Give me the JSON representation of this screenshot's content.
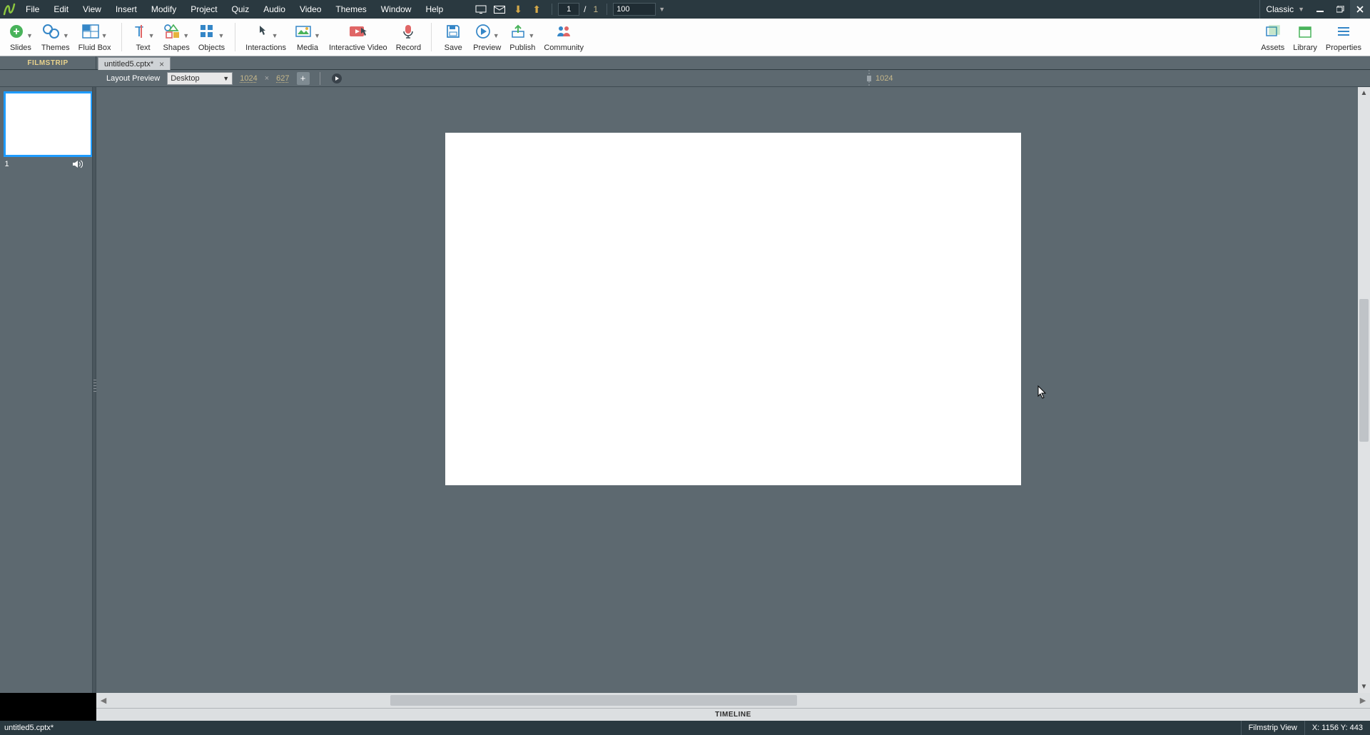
{
  "menu": {
    "items": [
      "File",
      "Edit",
      "View",
      "Insert",
      "Modify",
      "Project",
      "Quiz",
      "Audio",
      "Video",
      "Themes",
      "Window",
      "Help"
    ]
  },
  "pagenav": {
    "current": "1",
    "sep": "/",
    "total": "1"
  },
  "zoom": {
    "value": "100"
  },
  "workspace": {
    "name": "Classic"
  },
  "toolbar": {
    "slides": "Slides",
    "themes": "Themes",
    "fluidbox": "Fluid Box",
    "text": "Text",
    "shapes": "Shapes",
    "objects": "Objects",
    "interactions": "Interactions",
    "media": "Media",
    "interactive_video": "Interactive Video",
    "record": "Record",
    "save": "Save",
    "preview": "Preview",
    "publish": "Publish",
    "community": "Community",
    "assets": "Assets",
    "library": "Library",
    "properties": "Properties"
  },
  "filmstrip": {
    "title": "FILMSTRIP"
  },
  "tab": {
    "name": "untitled5.cptx*"
  },
  "layout": {
    "label": "Layout Preview",
    "mode": "Desktop",
    "w": "1024",
    "h": "627",
    "ruler": "1024"
  },
  "slide": {
    "num": "1"
  },
  "timeline": {
    "title": "TIMELINE"
  },
  "status": {
    "doc": "untitled5.cptx*",
    "view": "Filmstrip View",
    "coords": "X: 1156 Y: 443"
  }
}
